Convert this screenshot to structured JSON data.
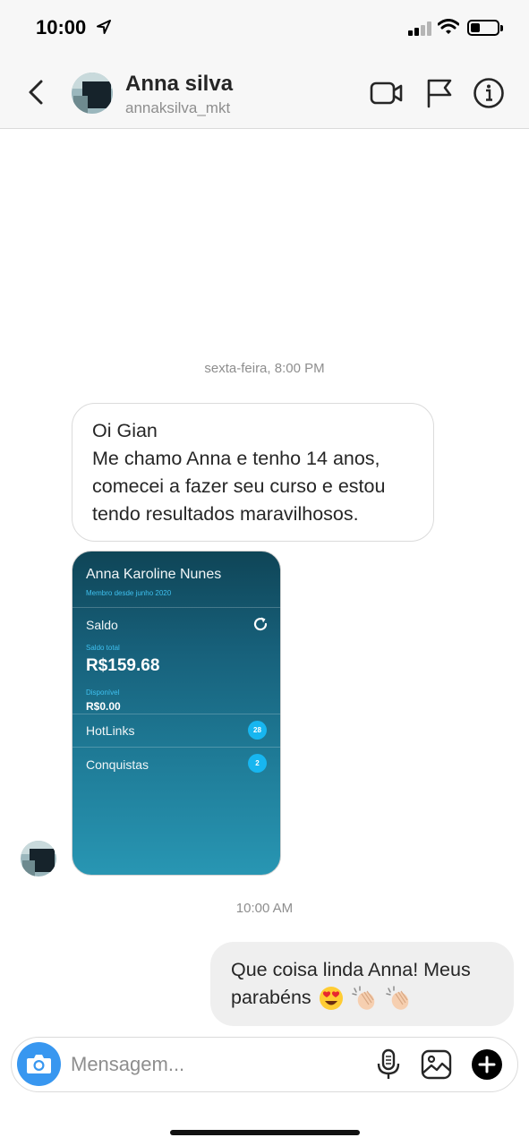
{
  "status_bar": {
    "time": "10:00",
    "icons": [
      "location-arrow-icon",
      "signal-icon",
      "wifi-icon",
      "battery-icon"
    ]
  },
  "header": {
    "name": "Anna silva",
    "username": "annaksilva_mkt",
    "icons": [
      "back-chevron-icon",
      "video-call-icon",
      "flag-icon",
      "info-icon"
    ]
  },
  "chat": {
    "timestamp_1": "sexta-feira, 8:00 PM",
    "incoming_message": {
      "lines": [
        "Oi Gian",
        "Me chamo Anna e tenho 14 anos,",
        "comecei a fazer seu curso e estou",
        "tendo resultados maravilhosos."
      ]
    },
    "shared_screenshot": {
      "name": "Anna Karoline Nunes",
      "member_since": "Membro desde junho 2020",
      "saldo_label": "Saldo",
      "saldo_total_label": "Saldo total",
      "saldo_total_value": "R$159.68",
      "disponivel_label": "Disponível",
      "disponivel_value": "R$0.00",
      "hotlinks_label": "HotLinks",
      "hotlinks_count": "28",
      "conquistas_label": "Conquistas",
      "conquistas_count": "2"
    },
    "timestamp_2": "10:00 AM",
    "outgoing_message": {
      "line1": "Que coisa linda Anna! Meus",
      "line2": "parabéns",
      "emojis": [
        "heart-eyes-emoji",
        "clapping-hands-emoji",
        "clapping-hands-emoji"
      ]
    }
  },
  "composer": {
    "placeholder": "Mensagem...",
    "icons": [
      "camera-icon",
      "microphone-icon",
      "gallery-icon",
      "plus-icon"
    ]
  },
  "colors": {
    "accent_blue": "#3897f0",
    "screenshot_badge": "#17b6f0",
    "bubble_outgoing": "#efefef",
    "text_secondary": "#8e8e8e"
  }
}
